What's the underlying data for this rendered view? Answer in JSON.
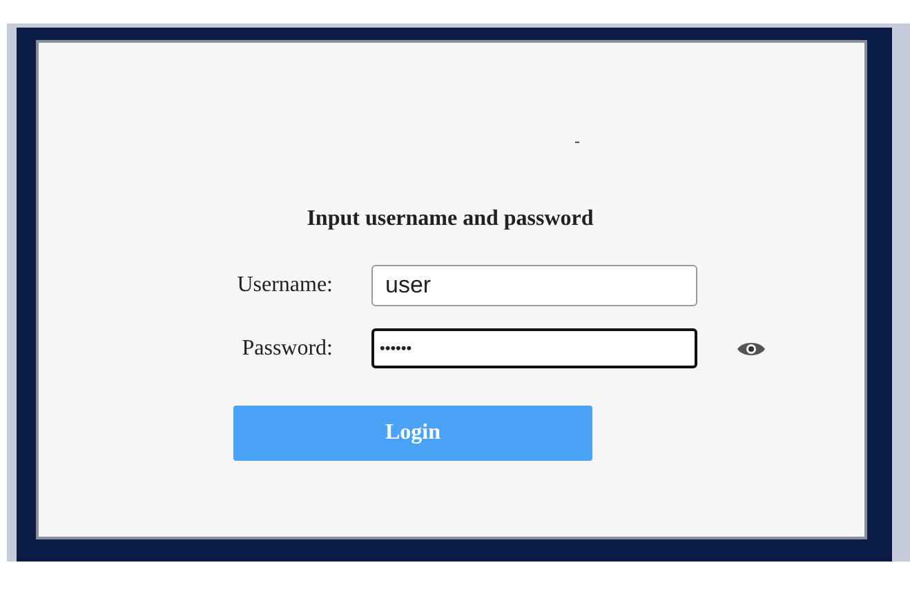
{
  "marker": "-",
  "heading": "Input username and password",
  "fields": [
    {
      "label": "Username:",
      "value": "user",
      "focused": false,
      "masked": false
    },
    {
      "label": "Password:",
      "value": "••••••",
      "focused": true,
      "masked": true
    }
  ],
  "login_button": {
    "label": "Login"
  }
}
